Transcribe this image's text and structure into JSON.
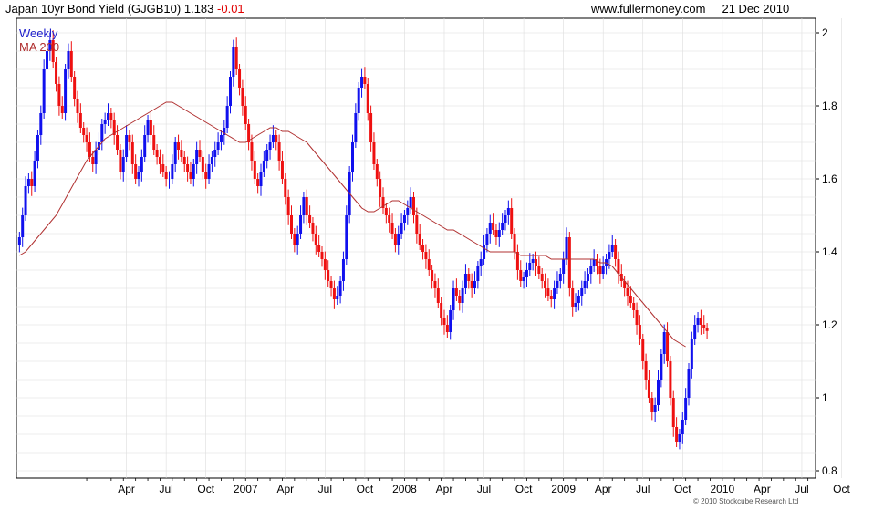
{
  "header": {
    "title": "Japan 10yr Bond Yield (GJGB10)",
    "last_value": "1.183",
    "change": "-0.01",
    "site": "www.fullermoney.com",
    "date": "21 Dec 2010"
  },
  "footer": {
    "copyright": "© 2010 Stockcube Research Ltd"
  },
  "colors": {
    "up": "#1010ee",
    "down": "#ee1010",
    "ma": "#b03030",
    "grid": "#dddddd",
    "legend_weekly": "#2020cc",
    "legend_ma": "#b03030"
  },
  "chart_data": {
    "type": "line",
    "title": "Japan 10yr Bond Yield (GJGB10)",
    "legend": [
      "Weekly",
      "MA 200"
    ],
    "legend_placement": "top-left",
    "x_tick_labels": [
      "Apr",
      "Jul",
      "Oct",
      "2007",
      "Apr",
      "Jul",
      "Oct",
      "2008",
      "Apr",
      "Jul",
      "Oct",
      "2009",
      "Apr",
      "Jul",
      "Oct",
      "2010",
      "Apr",
      "Jul",
      "Oct"
    ],
    "y_tick_labels": [
      "0.8",
      "1",
      "1.2",
      "1.4",
      "1.6",
      "1.8",
      "2"
    ],
    "ylim": [
      0.78,
      2.04
    ],
    "grid": true,
    "x_start": "2006-01-01",
    "week_ticks": [
      {
        "label": "Apr",
        "week": 13
      },
      {
        "label": "Jul",
        "week": 26
      },
      {
        "label": "Oct",
        "week": 39
      },
      {
        "label": "2007",
        "week": 52
      },
      {
        "label": "Apr",
        "week": 65
      },
      {
        "label": "Jul",
        "week": 78
      },
      {
        "label": "Oct",
        "week": 91
      },
      {
        "label": "2008",
        "week": 104
      },
      {
        "label": "Apr",
        "week": 117
      },
      {
        "label": "Jul",
        "week": 130
      },
      {
        "label": "Oct",
        "week": 143
      },
      {
        "label": "2009",
        "week": 156
      },
      {
        "label": "Apr",
        "week": 169
      },
      {
        "label": "Jul",
        "week": 182
      },
      {
        "label": "Oct",
        "week": 195
      },
      {
        "label": "2010",
        "week": 208
      },
      {
        "label": "Apr",
        "week": 221
      },
      {
        "label": "Jul",
        "week": 234
      },
      {
        "label": "Oct",
        "week": 247
      }
    ],
    "series": [
      {
        "name": "Weekly",
        "type": "ohlc-bars",
        "close": [
          1.44,
          1.5,
          1.58,
          1.6,
          1.58,
          1.65,
          1.72,
          1.78,
          1.9,
          1.95,
          1.98,
          1.92,
          1.86,
          1.8,
          1.78,
          1.9,
          1.95,
          1.88,
          1.82,
          1.78,
          1.74,
          1.72,
          1.7,
          1.66,
          1.64,
          1.68,
          1.7,
          1.75,
          1.76,
          1.78,
          1.76,
          1.72,
          1.68,
          1.62,
          1.66,
          1.72,
          1.7,
          1.64,
          1.6,
          1.62,
          1.66,
          1.72,
          1.76,
          1.72,
          1.68,
          1.66,
          1.64,
          1.62,
          1.6,
          1.6,
          1.64,
          1.7,
          1.68,
          1.66,
          1.64,
          1.62,
          1.6,
          1.64,
          1.68,
          1.66,
          1.62,
          1.6,
          1.64,
          1.66,
          1.68,
          1.7,
          1.72,
          1.74,
          1.8,
          1.88,
          1.96,
          1.9,
          1.85,
          1.8,
          1.75,
          1.7,
          1.65,
          1.6,
          1.58,
          1.62,
          1.65,
          1.68,
          1.7,
          1.72,
          1.7,
          1.65,
          1.6,
          1.55,
          1.5,
          1.45,
          1.42,
          1.45,
          1.5,
          1.55,
          1.5,
          1.48,
          1.45,
          1.42,
          1.4,
          1.38,
          1.35,
          1.32,
          1.3,
          1.27,
          1.28,
          1.32,
          1.38,
          1.5,
          1.62,
          1.7,
          1.78,
          1.85,
          1.88,
          1.86,
          1.78,
          1.7,
          1.64,
          1.6,
          1.55,
          1.52,
          1.5,
          1.48,
          1.45,
          1.42,
          1.45,
          1.48,
          1.5,
          1.52,
          1.55,
          1.5,
          1.45,
          1.42,
          1.4,
          1.38,
          1.35,
          1.32,
          1.3,
          1.26,
          1.22,
          1.2,
          1.18,
          1.24,
          1.3,
          1.28,
          1.26,
          1.3,
          1.34,
          1.32,
          1.3,
          1.32,
          1.36,
          1.38,
          1.42,
          1.45,
          1.48,
          1.46,
          1.44,
          1.46,
          1.48,
          1.5,
          1.52,
          1.45,
          1.4,
          1.35,
          1.32,
          1.33,
          1.35,
          1.37,
          1.38,
          1.36,
          1.34,
          1.32,
          1.3,
          1.28,
          1.27,
          1.3,
          1.32,
          1.34,
          1.38,
          1.44,
          1.3,
          1.25,
          1.26,
          1.28,
          1.3,
          1.32,
          1.34,
          1.36,
          1.38,
          1.36,
          1.34,
          1.36,
          1.38,
          1.4,
          1.42,
          1.38,
          1.34,
          1.32,
          1.3,
          1.28,
          1.26,
          1.24,
          1.2,
          1.16,
          1.1,
          1.05,
          1.0,
          0.96,
          0.98,
          1.05,
          1.12,
          1.18,
          1.1,
          1.0,
          0.92,
          0.88,
          0.9,
          0.94,
          1.0,
          1.08,
          1.16,
          1.2,
          1.22,
          1.2,
          1.19,
          1.183
        ]
      },
      {
        "name": "MA 200",
        "type": "line",
        "values": [
          1.39,
          1.4,
          1.42,
          1.44,
          1.46,
          1.48,
          1.5,
          1.53,
          1.56,
          1.59,
          1.62,
          1.65,
          1.67,
          1.69,
          1.71,
          1.72,
          1.73,
          1.74,
          1.75,
          1.76,
          1.77,
          1.78,
          1.79,
          1.8,
          1.81,
          1.81,
          1.8,
          1.79,
          1.78,
          1.77,
          1.76,
          1.75,
          1.74,
          1.73,
          1.72,
          1.71,
          1.7,
          1.7,
          1.71,
          1.72,
          1.73,
          1.74,
          1.74,
          1.73,
          1.73,
          1.72,
          1.71,
          1.7,
          1.68,
          1.66,
          1.64,
          1.62,
          1.6,
          1.58,
          1.56,
          1.54,
          1.52,
          1.51,
          1.51,
          1.52,
          1.53,
          1.54,
          1.54,
          1.53,
          1.52,
          1.51,
          1.5,
          1.49,
          1.48,
          1.47,
          1.46,
          1.46,
          1.45,
          1.44,
          1.43,
          1.42,
          1.41,
          1.4,
          1.4,
          1.4,
          1.4,
          1.4,
          1.39,
          1.39,
          1.39,
          1.39,
          1.39,
          1.38,
          1.38,
          1.38,
          1.38,
          1.38,
          1.38,
          1.38,
          1.38,
          1.37,
          1.37,
          1.36,
          1.34,
          1.32,
          1.3,
          1.28,
          1.26,
          1.24,
          1.22,
          1.2,
          1.18,
          1.16,
          1.15,
          1.14
        ]
      }
    ],
    "xlabel": "",
    "ylabel": ""
  }
}
